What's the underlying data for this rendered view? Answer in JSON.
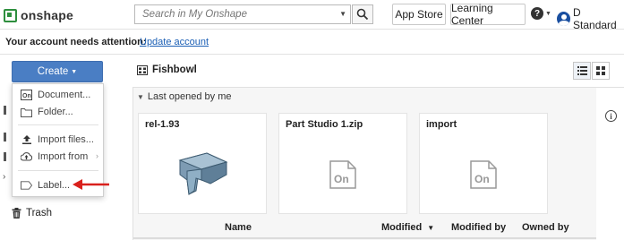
{
  "app": {
    "logo_text": "onshape",
    "brand_color": "#2e8f3e"
  },
  "search": {
    "placeholder": "Search in My Onshape"
  },
  "topnav": {
    "app_store": "App Store",
    "learning_center": "Learning Center",
    "user_name": "D Standard"
  },
  "attention": {
    "message": "Your account needs attention:",
    "link": "Update account"
  },
  "create": {
    "label": "Create"
  },
  "menu": {
    "items": [
      {
        "label": "Document...",
        "icon": "onshape-document-icon"
      },
      {
        "label": "Folder...",
        "icon": "folder-icon"
      },
      {
        "label": "Import files...",
        "icon": "upload-icon"
      },
      {
        "label": "Import from",
        "icon": "cloud-upload-icon"
      },
      {
        "label": "Label...",
        "icon": "label-tag-icon"
      }
    ]
  },
  "sidebar": {
    "trash": "Trash"
  },
  "breadcrumb": {
    "label": "Fishbowl"
  },
  "section": {
    "title": "Last opened by me"
  },
  "cards": [
    {
      "title": "rel-1.93"
    },
    {
      "title": "Part Studio 1.zip"
    },
    {
      "title": "import"
    }
  ],
  "table": {
    "columns": {
      "name": "Name",
      "modified": "Modified",
      "modified_by": "Modified by",
      "owned_by": "Owned by"
    }
  },
  "colors": {
    "accent": "#4a7ec4",
    "link": "#1b5fb5",
    "annotation_arrow": "#d9201c"
  }
}
